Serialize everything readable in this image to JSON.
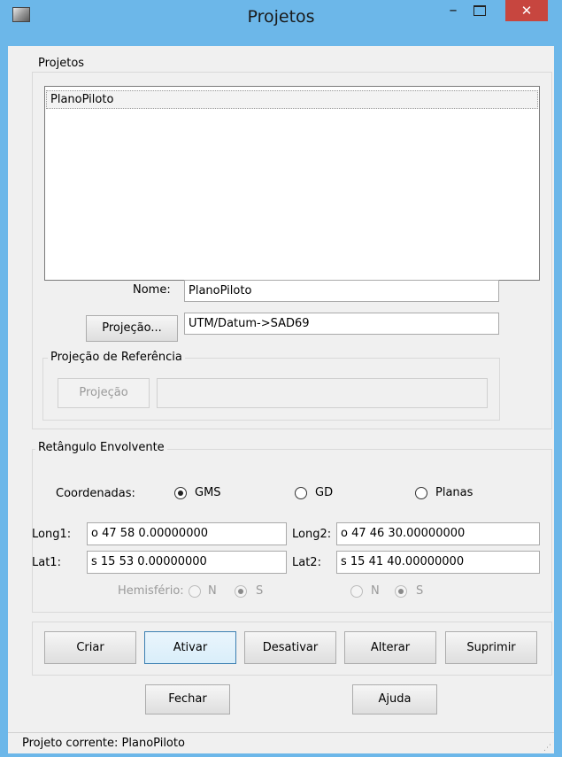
{
  "window": {
    "title": "Projetos",
    "minimize_glyph": "–",
    "close_glyph": "✕",
    "icon": "app-icon"
  },
  "projetos_group": {
    "legend": "Projetos",
    "list_items": [
      "PlanoPiloto"
    ],
    "nome_label": "Nome:",
    "nome_value": "PlanoPiloto",
    "projecao_button": "Projeção...",
    "projecao_value": "UTM/Datum->SAD69"
  },
  "referencia_group": {
    "legend": "Projeção de Referência",
    "projecao_button": "Projeção",
    "projecao_value": ""
  },
  "retangulo_group": {
    "legend": "Retângulo Envolvente",
    "coordenadas_label": "Coordenadas:",
    "options": [
      "GMS",
      "GD",
      "Planas"
    ],
    "selected": "GMS",
    "long1_label": "Long1:",
    "long1_value": "o 47 58 0.00000000",
    "long2_label": "Long2:",
    "long2_value": "o 47 46 30.00000000",
    "lat1_label": "Lat1:",
    "lat1_value": "s 15 53 0.00000000",
    "lat2_label": "Lat2:",
    "lat2_value": "s 15 41 40.00000000",
    "hemisferio_label": "Hemisfério:",
    "hemi_n": "N",
    "hemi_s": "S"
  },
  "actions": {
    "criar": "Criar",
    "ativar": "Ativar",
    "desativar": "Desativar",
    "alterar": "Alterar",
    "suprimir": "Suprimir",
    "fechar": "Fechar",
    "ajuda": "Ajuda"
  },
  "status": {
    "text": "Projeto corrente: PlanoPiloto"
  }
}
